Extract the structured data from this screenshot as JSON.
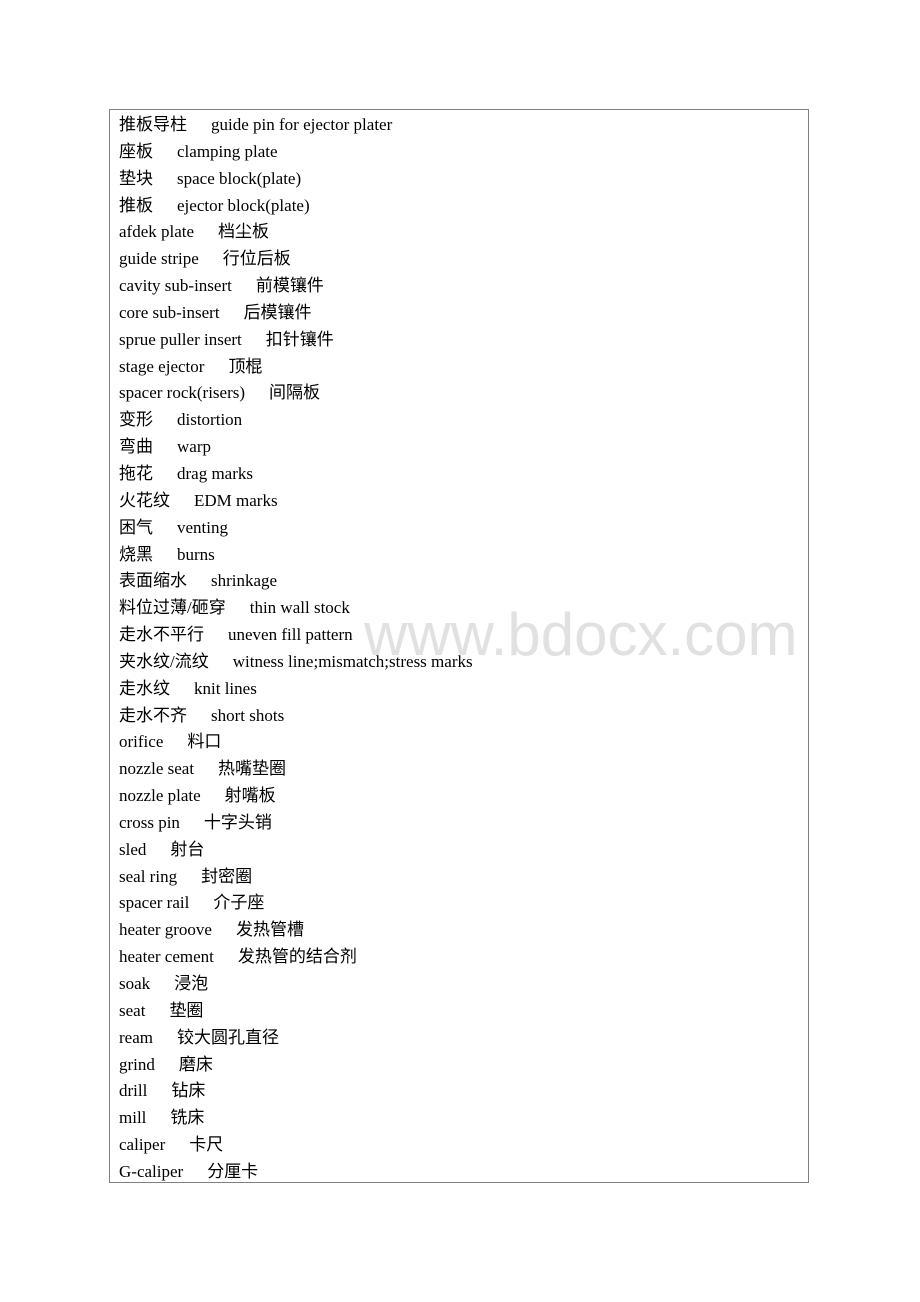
{
  "watermark": "www.bdocx.com",
  "glossary": [
    {
      "a": "推板导柱",
      "b": "guide pin for ejector plater"
    },
    {
      "a": "座板",
      "b": "clamping plate"
    },
    {
      "a": "垫块",
      "b": "space block(plate)"
    },
    {
      "a": "推板",
      "b": "ejector block(plate)"
    },
    {
      "a": "afdek plate",
      "b": "档尘板"
    },
    {
      "a": "guide stripe",
      "b": "行位后板"
    },
    {
      "a": "cavity sub-insert",
      "b": "前模镶件"
    },
    {
      "a": "core sub-insert",
      "b": "后模镶件"
    },
    {
      "a": "sprue puller insert",
      "b": "扣针镶件"
    },
    {
      "a": "stage ejector",
      "b": "顶棍"
    },
    {
      "a": "spacer rock(risers)",
      "b": "间隔板"
    },
    {
      "a": "变形",
      "b": "distortion"
    },
    {
      "a": "弯曲",
      "b": "warp"
    },
    {
      "a": "拖花",
      "b": "drag marks"
    },
    {
      "a": "火花纹",
      "b": "EDM marks"
    },
    {
      "a": "困气",
      "b": "venting"
    },
    {
      "a": "烧黑",
      "b": "burns"
    },
    {
      "a": "表面缩水",
      "b": "shrinkage"
    },
    {
      "a": "料位过薄/砸穿",
      "b": "thin wall stock"
    },
    {
      "a": "走水不平行",
      "b": "uneven fill pattern"
    },
    {
      "a": "夹水纹/流纹",
      "b": "witness line;mismatch;stress marks"
    },
    {
      "a": "走水纹",
      "b": "knit lines"
    },
    {
      "a": "走水不齐",
      "b": "short shots"
    },
    {
      "a": "orifice",
      "b": "料口"
    },
    {
      "a": "nozzle seat",
      "b": "热嘴垫圈"
    },
    {
      "a": "nozzle plate",
      "b": "射嘴板"
    },
    {
      "a": "cross pin",
      "b": "十字头销"
    },
    {
      "a": "sled",
      "b": "射台"
    },
    {
      "a": "seal ring",
      "b": "封密圈"
    },
    {
      "a": "spacer rail",
      "b": "介子座"
    },
    {
      "a": "heater groove",
      "b": "发热管槽"
    },
    {
      "a": "heater cement",
      "b": "发热管的结合剂"
    },
    {
      "a": "soak",
      "b": "浸泡"
    },
    {
      "a": "seat",
      "b": "垫圈"
    },
    {
      "a": "ream",
      "b": "铰大圆孔直径"
    },
    {
      "a": "grind",
      "b": "磨床"
    },
    {
      "a": "drill",
      "b": "钻床"
    },
    {
      "a": "mill",
      "b": "铣床"
    },
    {
      "a": "caliper",
      "b": "卡尺"
    },
    {
      "a": "G-caliper",
      "b": "分厘卡"
    }
  ]
}
